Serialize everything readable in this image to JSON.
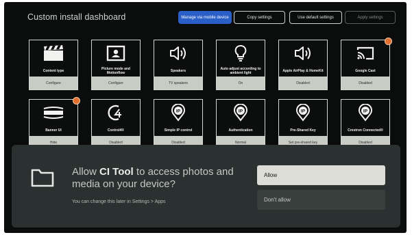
{
  "header": {
    "title": "Custom install dashboard",
    "buttons": [
      {
        "label": "Manage via mobile device"
      },
      {
        "label": "Copy settings"
      },
      {
        "label": "Use default settings"
      },
      {
        "label": "Apply settings"
      }
    ]
  },
  "tiles": [
    {
      "label": "Content type",
      "value": "Configure",
      "icon": "clapperboard-icon"
    },
    {
      "label": "Picture mode and Motionflow",
      "value": "Configure",
      "icon": "picture-icon"
    },
    {
      "label": "Speakers",
      "value": "TV speakers",
      "icon": "speaker-icon"
    },
    {
      "label": "Auto adjust according to ambient light",
      "value": "On",
      "icon": "lightbulb-icon"
    },
    {
      "label": "Apple AirPlay & HomeKit",
      "value": "Disabled",
      "icon": "speaker-icon"
    },
    {
      "label": "Google Cast",
      "value": "Disabled",
      "icon": "cast-icon",
      "badge": true
    },
    {
      "label": "Banner UI",
      "value": "Hide",
      "icon": "banner-icon",
      "badge": true
    },
    {
      "label": "Control4®",
      "value": "Disabled",
      "icon": "control4-icon"
    },
    {
      "label": "Simple IP control",
      "value": "Disabled",
      "icon": "ip-pin-icon"
    },
    {
      "label": "Authentication",
      "value": "Normal",
      "icon": "ip-pin-icon"
    },
    {
      "label": "Pre-Shared Key",
      "value": "Set pre-shared key",
      "icon": "ip-pin-icon"
    },
    {
      "label": "Crestron Connected®",
      "value": "Disabled",
      "icon": "ip-pin-icon"
    }
  ],
  "dialog": {
    "question_prefix": "Allow ",
    "app_name": "CI Tool",
    "question_suffix": " to access photos and media on your device?",
    "hint": "You can change this later in Settings > Apps",
    "allow_label": "Allow",
    "deny_label": "Don't allow",
    "icon": "folder-icon"
  },
  "colors": {
    "background": "#0b0d0c",
    "primary_button": "#2a5fc7",
    "tile_value_bg": "#c9cbc5",
    "badge": "#e3702f",
    "dialog_bg": "#2b3130",
    "allow_bg": "#dcddd6"
  }
}
